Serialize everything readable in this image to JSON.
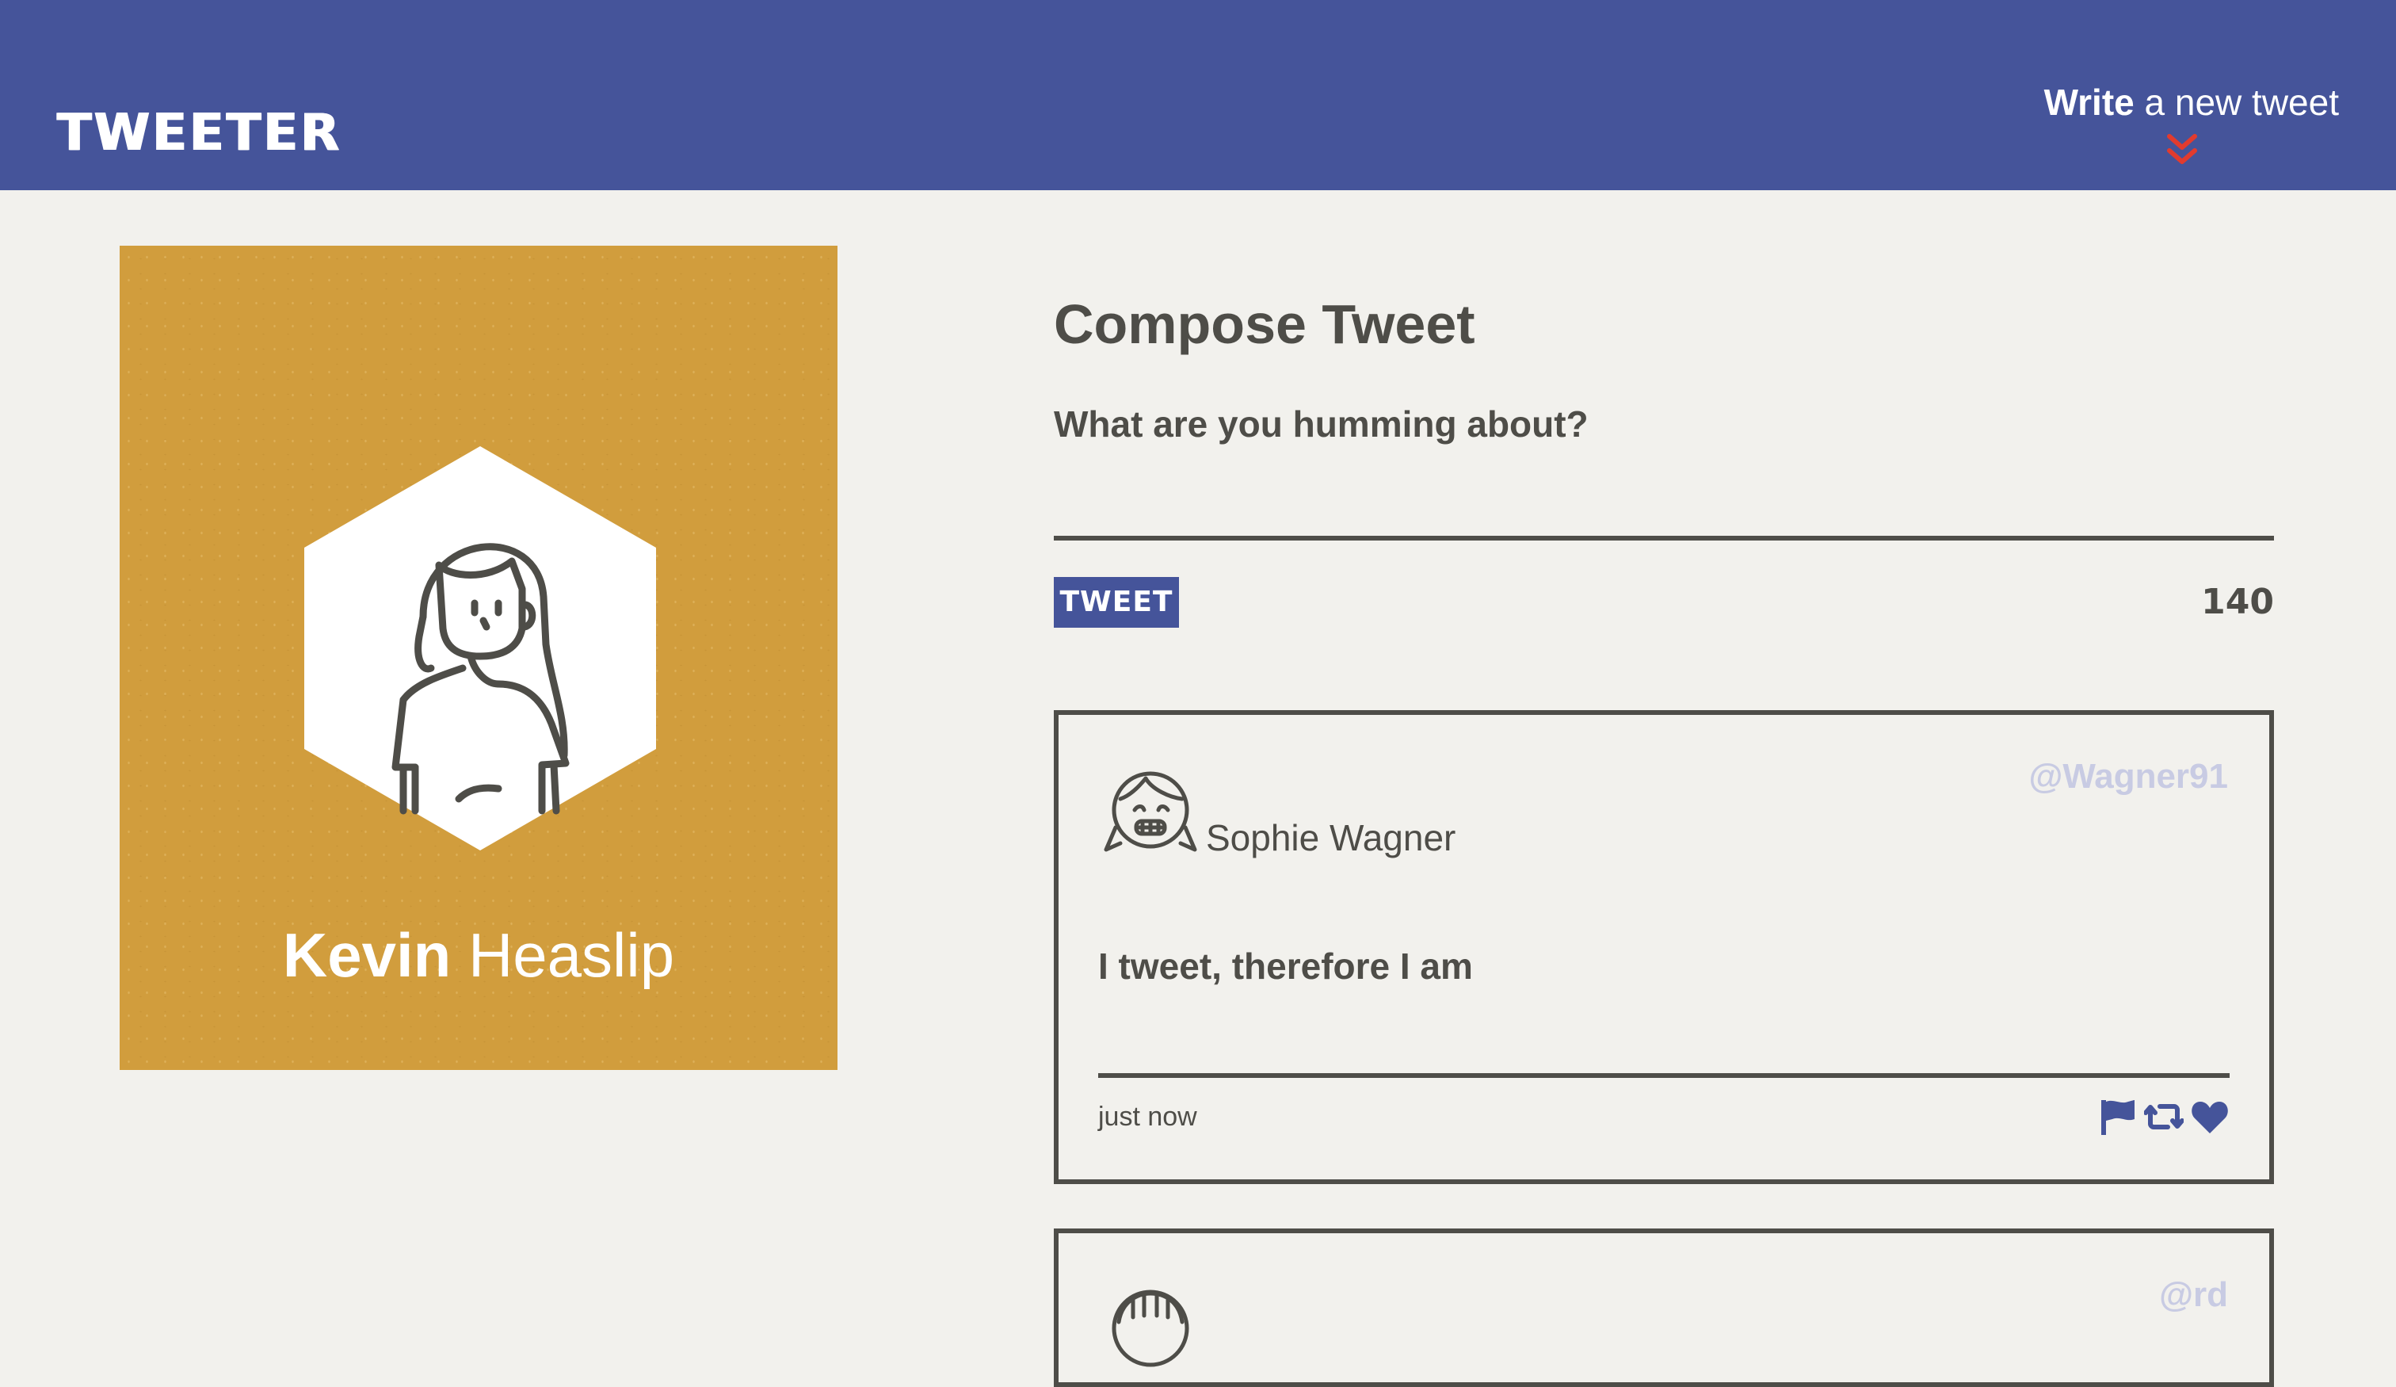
{
  "header": {
    "brand": "TWEETER",
    "compose_toggle": {
      "bold": "Write",
      "rest": " a new tweet",
      "icon": "double-chevron-down-icon"
    }
  },
  "profile": {
    "first_name": "Kevin",
    "last_name": "Heaslip",
    "avatar_icon": "woman-avatar-hexagon",
    "background_color": "#d19d3d"
  },
  "compose": {
    "title": "Compose Tweet",
    "prompt": "What are you humming about?",
    "text_value": "",
    "button_label": "TWEET",
    "char_counter": "140"
  },
  "tweets": [
    {
      "author": "Sophie Wagner",
      "handle": "@Wagner91",
      "content": "I tweet, therefore I am",
      "timestamp": "just now",
      "avatar_icon": "girl-avatar-icon",
      "actions": [
        "flag-icon",
        "retweet-icon",
        "heart-icon"
      ]
    },
    {
      "author": "",
      "handle": "@rd",
      "content": "",
      "timestamp": "",
      "avatar_icon": "avatar-icon"
    }
  ],
  "colors": {
    "header_bg": "#45549a",
    "page_bg": "#f2f1ed",
    "text": "#4e4d48",
    "accent": "#e23b2e",
    "handle": "#c8cbe3"
  }
}
